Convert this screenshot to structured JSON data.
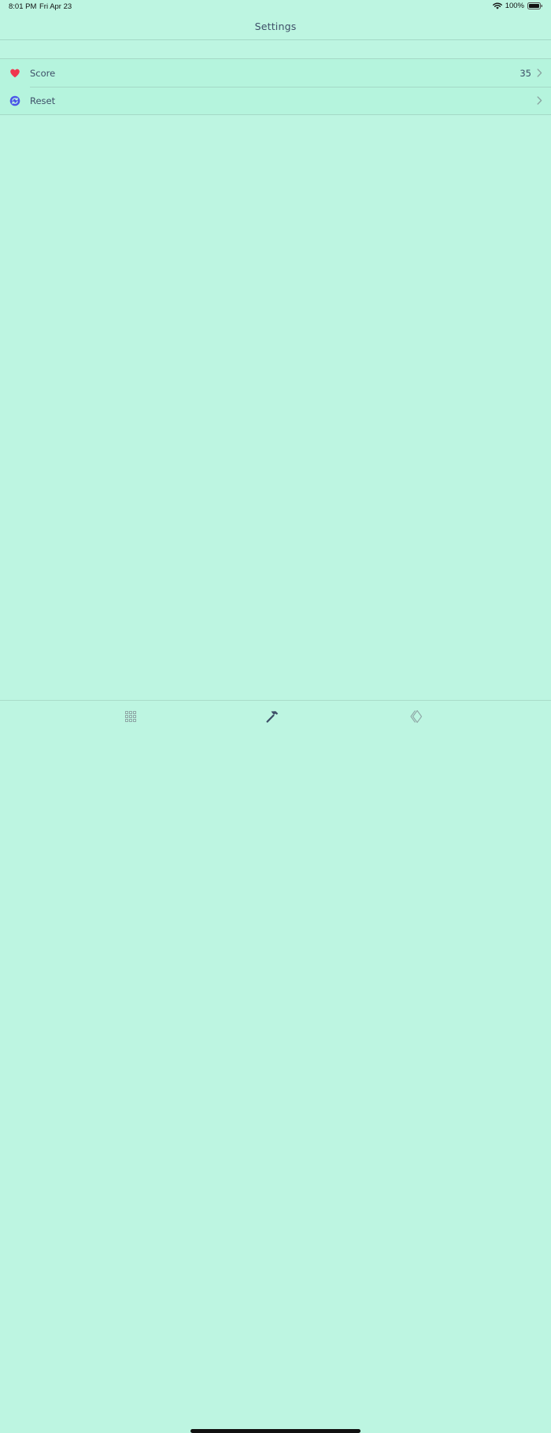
{
  "status_bar": {
    "time": "8:01 PM",
    "date": "Fri Apr 23",
    "battery": "100%"
  },
  "nav": {
    "title": "Settings"
  },
  "settings": {
    "rows": [
      {
        "label": "Score",
        "value": "35",
        "icon": "heart-icon",
        "icon_color": "#f0364f"
      },
      {
        "label": "Reset",
        "value": "",
        "icon": "reset-icon",
        "icon_color": "#4a54e8"
      }
    ]
  },
  "tab_bar": {
    "tabs": [
      {
        "icon": "grid-icon",
        "selected": false
      },
      {
        "icon": "hammer-icon",
        "selected": true
      },
      {
        "icon": "diamond-icon",
        "selected": false
      }
    ]
  },
  "colors": {
    "background": "#bdf5e1",
    "row_background": "#b5f4dd",
    "text": "#3e4f68",
    "separator": "#a4d8c6",
    "heart": "#f0364f",
    "reset": "#4a54e8"
  }
}
